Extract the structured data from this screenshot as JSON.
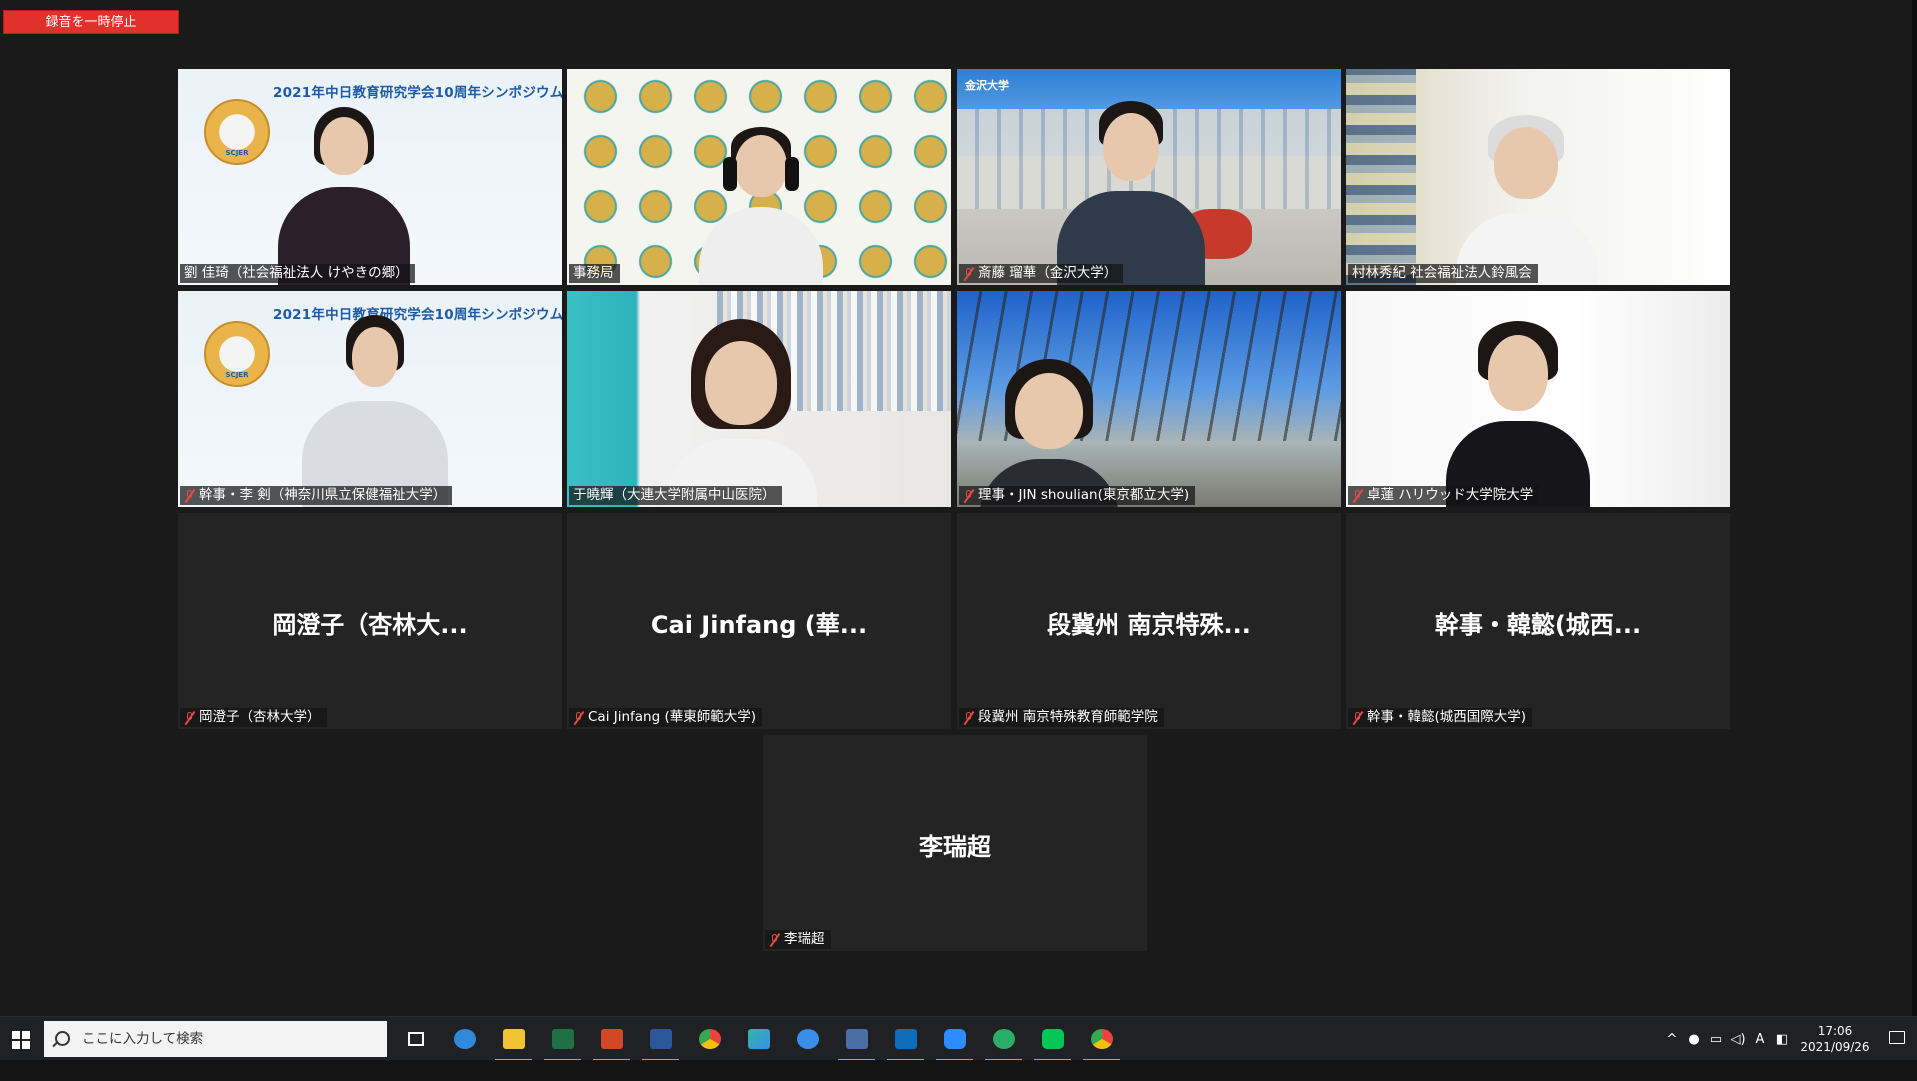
{
  "meeting": {
    "recording_button": "録音を一時停止",
    "banner_title": "2021年中日教育研究学会10周年シンポジウム",
    "logo_text": "SCJER",
    "building_sign": "金沢大学"
  },
  "participants": [
    {
      "label": "劉 佳琦（社会福祉法人 けやきの郷）",
      "muted": false,
      "video": true
    },
    {
      "label": "事務局",
      "muted": false,
      "video": true,
      "speaking": true
    },
    {
      "label": "斎藤 瑠華（金沢大学）",
      "muted": true,
      "video": true
    },
    {
      "label": "村林秀紀 社会福祉法人鈴風会",
      "muted": false,
      "video": true
    },
    {
      "label": "幹事・李 剣（神奈川県立保健福祉大学）",
      "muted": true,
      "video": true
    },
    {
      "label": "于曉輝（大連大学附属中山医院）",
      "muted": false,
      "video": true
    },
    {
      "label": "理事・JIN shoulian(東京都立大学)",
      "muted": true,
      "video": true
    },
    {
      "label": "卓蓮 ハリウッド大学院大学",
      "muted": true,
      "video": true
    },
    {
      "label": "岡澄子（杏林大学）",
      "display": "岡澄子（杏林大...",
      "muted": true,
      "video": false
    },
    {
      "label": "Cai Jinfang (華東師範大学)",
      "display": "Cai Jinfang (華...",
      "muted": true,
      "video": false
    },
    {
      "label": "段冀州 南京特殊教育師範学院",
      "display": "段冀州 南京特殊...",
      "muted": true,
      "video": false
    },
    {
      "label": "幹事・韓懿(城西国際大学)",
      "display": "幹事・韓懿(城西...",
      "muted": true,
      "video": false
    },
    {
      "label": "李瑞超",
      "display": "李瑞超",
      "muted": true,
      "video": false
    }
  ],
  "taskbar": {
    "search_placeholder": "ここに入力して検索",
    "apps": [
      {
        "icon": "task-view-icon",
        "color": "#ffffff"
      },
      {
        "icon": "edge-icon",
        "color": "#2f8ad9"
      },
      {
        "icon": "file-explorer-icon",
        "color": "#f1c232"
      },
      {
        "icon": "excel-icon",
        "color": "#1e7145"
      },
      {
        "icon": "powerpoint-icon",
        "color": "#d24726"
      },
      {
        "icon": "word-icon",
        "color": "#2b579a"
      },
      {
        "icon": "chrome-icon",
        "color": "#e8453c"
      },
      {
        "icon": "app-green-blue-icon",
        "color": "#2fb7a9"
      },
      {
        "icon": "app-blue-bird-icon",
        "color": "#3a8ee6"
      },
      {
        "icon": "app-presenter-icon",
        "color": "#4a6fa5"
      },
      {
        "icon": "outlook-icon",
        "color": "#0f6cbd"
      },
      {
        "icon": "zoom-icon",
        "color": "#2d8cff"
      },
      {
        "icon": "wechat-icon",
        "color": "#2aae67"
      },
      {
        "icon": "line-icon",
        "color": "#06c755"
      },
      {
        "icon": "chrome-profile-icon",
        "color": "#e8453c"
      }
    ],
    "ime_indicator": "A",
    "time": "17:06",
    "date": "2021/09/26"
  }
}
